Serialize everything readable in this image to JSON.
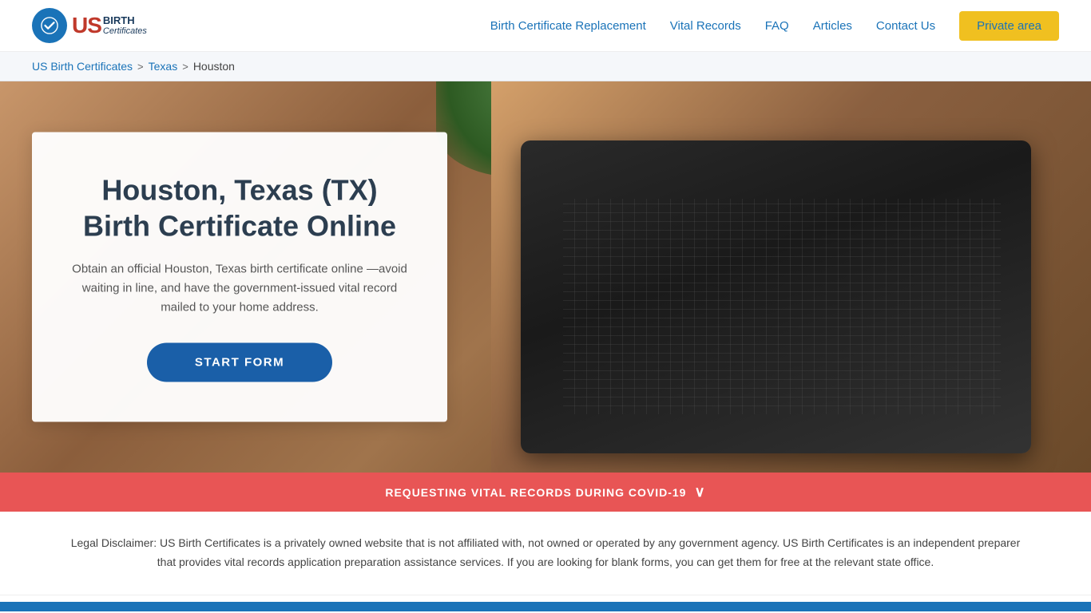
{
  "header": {
    "logo": {
      "us_text": "US",
      "birth_text": "BIRTH",
      "certs_text": "Certificates"
    },
    "nav": {
      "birth_cert": "Birth Certificate Replacement",
      "vital_records": "Vital Records",
      "faq": "FAQ",
      "articles": "Articles",
      "contact": "Contact Us",
      "private_area": "Private area"
    }
  },
  "breadcrumb": {
    "home": "US Birth Certificates",
    "sep1": ">",
    "state": "Texas",
    "sep2": ">",
    "city": "Houston"
  },
  "hero": {
    "title": "Houston, Texas (TX) Birth Certificate Online",
    "description": "Obtain an official Houston, Texas birth certificate online —avoid waiting in line, and have the government-issued vital record mailed to your home address.",
    "cta_button": "START FORM"
  },
  "covid_banner": {
    "text": "REQUESTING VITAL RECORDS DURING COVID-19",
    "chevron": "∨"
  },
  "disclaimer": {
    "text": "Legal Disclaimer: US Birth Certificates is a privately owned website that is not affiliated with, not owned or operated by any government agency. US Birth Certificates is an independent preparer that provides vital records application preparation assistance services. If you are looking for blank forms, you can get them for free at the relevant state office."
  }
}
